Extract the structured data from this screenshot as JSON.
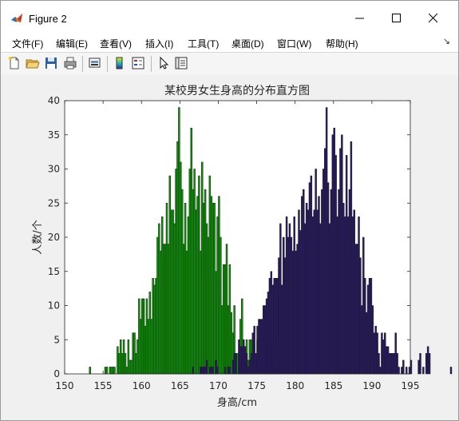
{
  "window": {
    "title": "Figure 2",
    "icon": "matlab-icon",
    "controls": [
      "minimize-icon",
      "maximize-icon",
      "close-icon"
    ]
  },
  "menu": {
    "items": [
      "文件(F)",
      "编辑(E)",
      "查看(V)",
      "插入(I)",
      "工具(T)",
      "桌面(D)",
      "窗口(W)",
      "帮助(H)"
    ],
    "dock_icon": "↘"
  },
  "toolbar": {
    "tools": [
      "new-figure-icon",
      "open-file-icon",
      "save-icon",
      "print-icon",
      "link-plot-icon",
      "insert-colorbar-icon",
      "insert-legend-icon",
      "edit-plot-icon",
      "property-inspector-icon"
    ]
  },
  "colors": {
    "male_bars": "#2a1a66",
    "female_bars": "#0a9a00",
    "bar_edge": "#1a1a1a"
  },
  "chart_data": {
    "type": "bar",
    "title": "某校男女生身高的分布直方图",
    "xlabel": "身高/cm",
    "ylabel": "人数/个",
    "xlim": [
      150,
      195
    ],
    "ylim": [
      0,
      40
    ],
    "xticks": [
      "150",
      "155",
      "160",
      "165",
      "170",
      "175",
      "180",
      "185",
      "190",
      "195"
    ],
    "yticks": [
      "0",
      "5",
      "10",
      "15",
      "20",
      "25",
      "30",
      "35",
      "40"
    ],
    "bin_width": 0.2,
    "grid": false,
    "legend": "none",
    "series": [
      {
        "color": "#0a9a00",
        "bin_start": 153.2,
        "values": [
          1,
          0,
          0,
          0,
          0,
          0,
          0,
          0,
          0,
          0,
          1,
          1,
          0,
          1,
          1,
          1,
          1,
          0,
          4,
          3,
          5,
          3,
          5,
          3,
          1,
          5,
          2,
          2,
          6,
          6,
          3,
          5,
          11,
          8,
          11,
          11,
          7,
          11,
          8,
          12,
          8,
          14,
          13,
          14,
          20,
          22,
          18,
          23,
          19,
          19,
          25,
          19,
          29,
          24,
          24,
          22,
          30,
          34,
          39,
          31,
          27,
          19,
          25,
          18,
          23,
          30,
          36,
          27,
          30,
          24,
          26,
          29,
          18,
          31,
          25,
          27,
          22,
          20,
          29,
          26,
          25,
          25,
          15,
          23,
          26,
          20,
          10,
          16,
          16,
          19,
          10,
          16,
          9,
          6,
          10,
          3,
          3,
          2,
          8,
          11,
          3,
          4,
          5,
          2,
          5,
          5,
          2,
          2,
          2,
          5,
          1,
          2,
          3,
          2,
          4,
          1,
          1,
          1,
          5,
          0,
          1,
          1,
          1,
          1,
          5
        ]
      },
      {
        "color": "#2a1a66",
        "bin_start": 166.6,
        "values": [
          1,
          0,
          0,
          0,
          0,
          1,
          1,
          1,
          1,
          2,
          0,
          1,
          1,
          1,
          0,
          2,
          1,
          0,
          0,
          0,
          0,
          1,
          0,
          1,
          1,
          0,
          2,
          3,
          3,
          0,
          5,
          4,
          4,
          5,
          4,
          3,
          1,
          2,
          3,
          6,
          7,
          3,
          7,
          8,
          8,
          8,
          10,
          10,
          11,
          12,
          14,
          15,
          13,
          14,
          14,
          14,
          17,
          22,
          13,
          20,
          17,
          23,
          20,
          22,
          20,
          18,
          23,
          18,
          19,
          24,
          21,
          26,
          27,
          22,
          25,
          24,
          28,
          29,
          23,
          24,
          30,
          24,
          26,
          22,
          27,
          30,
          33,
          39,
          28,
          22,
          27,
          35,
          36,
          32,
          23,
          27,
          33,
          35,
          25,
          23,
          32,
          23,
          27,
          34,
          23,
          24,
          19,
          19,
          23,
          17,
          10,
          20,
          14,
          9,
          13,
          14,
          14,
          10,
          6,
          7,
          6,
          3,
          1,
          6,
          5,
          6,
          4,
          4,
          3,
          3,
          3,
          3,
          6,
          3,
          1,
          0,
          1,
          2,
          0,
          1,
          0,
          1,
          2,
          0,
          0,
          0,
          0,
          2,
          3,
          0,
          1,
          0,
          3,
          4,
          3,
          0,
          0,
          0,
          0,
          0,
          0,
          0,
          0,
          0,
          0,
          0,
          0,
          0,
          1,
          0,
          0,
          0,
          0,
          0,
          0,
          0,
          0,
          0,
          0,
          0,
          1,
          0,
          0,
          0,
          0,
          0,
          0,
          0,
          0,
          0,
          0,
          0,
          0,
          0,
          0,
          0,
          0,
          0,
          0,
          0,
          0,
          0,
          0,
          0,
          0,
          0,
          0,
          0,
          0,
          1,
          0,
          0,
          0,
          0,
          1,
          0,
          0,
          0,
          0,
          0,
          0,
          0,
          0,
          0,
          0,
          0,
          0,
          0,
          0,
          0,
          0,
          0,
          0,
          0,
          0,
          0,
          0,
          1,
          0,
          1
        ]
      }
    ]
  }
}
